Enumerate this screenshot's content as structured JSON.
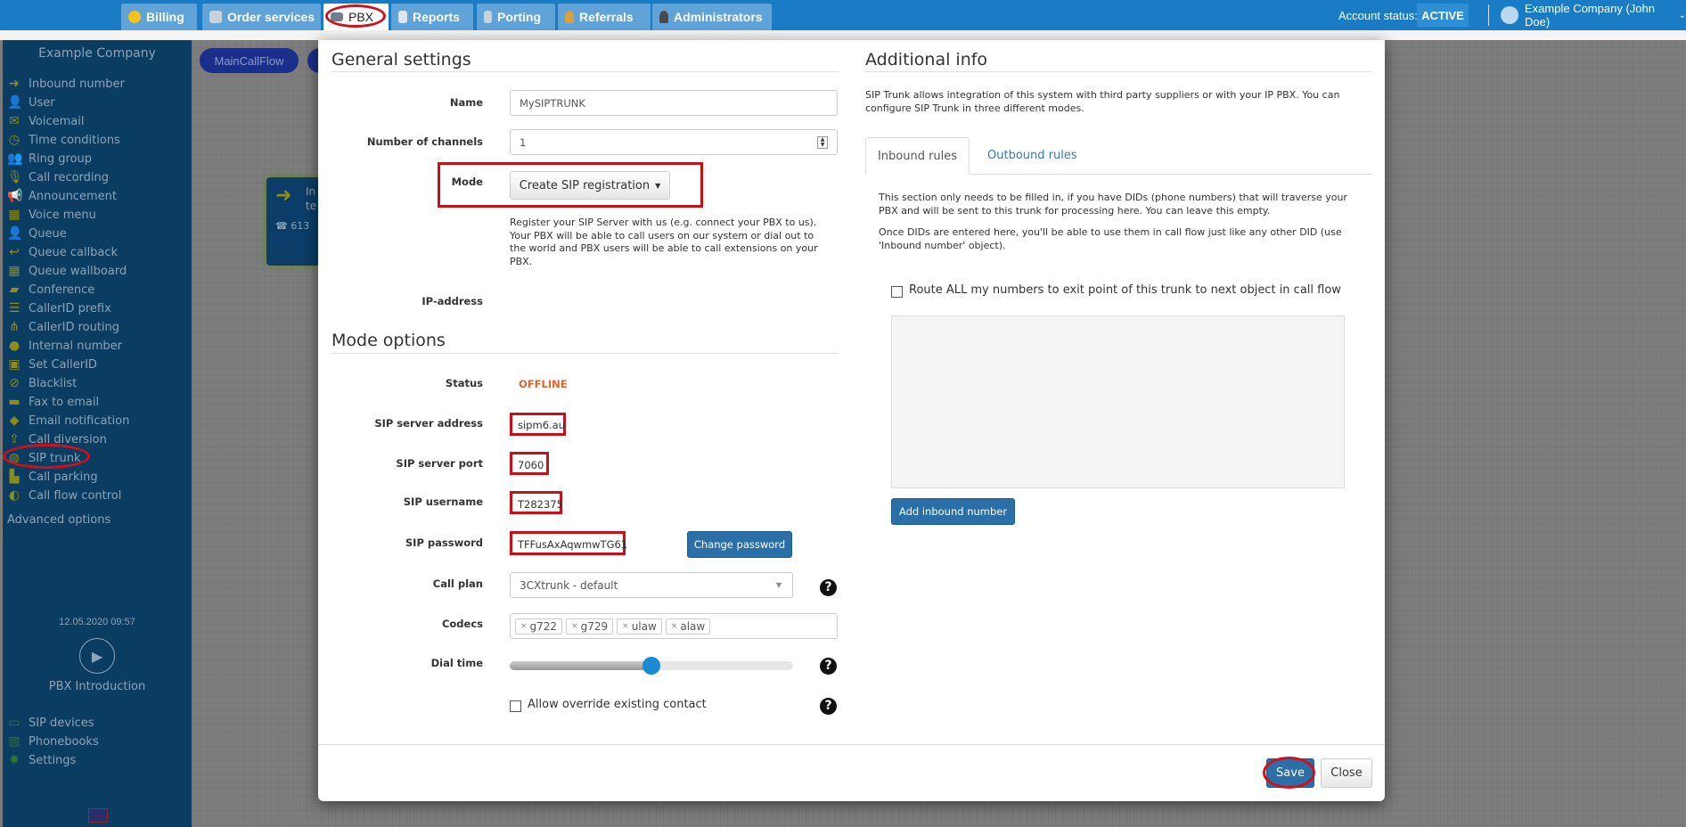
{
  "topnav": {
    "tabs": [
      {
        "label": "Billing",
        "icon": "coins-icon"
      },
      {
        "label": "Order services",
        "icon": "cart-icon"
      },
      {
        "label": "PBX",
        "icon": "pbx-icon",
        "active": true
      },
      {
        "label": "Reports",
        "icon": "report-icon"
      },
      {
        "label": "Porting",
        "icon": "phone-icon"
      },
      {
        "label": "Referrals",
        "icon": "person-icon"
      },
      {
        "label": "Administrators",
        "icon": "admin-icon"
      }
    ],
    "account_status_label": "Account status:",
    "account_status": "ACTIVE",
    "user": "Example Company (John Doe)"
  },
  "sidebar": {
    "company": "Example Company",
    "items": [
      {
        "label": "Inbound number",
        "icon": "arrow-right-icon"
      },
      {
        "label": "User",
        "icon": "user-icon"
      },
      {
        "label": "Voicemail",
        "icon": "envelope-icon"
      },
      {
        "label": "Time conditions",
        "icon": "clock-icon"
      },
      {
        "label": "Ring group",
        "icon": "group-icon"
      },
      {
        "label": "Call recording",
        "icon": "microphone-icon"
      },
      {
        "label": "Announcement",
        "icon": "megaphone-icon"
      },
      {
        "label": "Voice menu",
        "icon": "grid-icon"
      },
      {
        "label": "Queue",
        "icon": "user-plus-icon"
      },
      {
        "label": "Queue callback",
        "icon": "reply-icon"
      },
      {
        "label": "Queue wallboard",
        "icon": "table-icon"
      },
      {
        "label": "Conference",
        "icon": "chat-icon"
      },
      {
        "label": "CallerID prefix",
        "icon": "list-icon"
      },
      {
        "label": "CallerID routing",
        "icon": "sitemap-icon"
      },
      {
        "label": "Internal number",
        "icon": "pin-icon"
      },
      {
        "label": "Set CallerID",
        "icon": "id-card-icon"
      },
      {
        "label": "Blacklist",
        "icon": "ban-icon"
      },
      {
        "label": "Fax to email",
        "icon": "fax-icon"
      },
      {
        "label": "Email notification",
        "icon": "bell-icon"
      },
      {
        "label": "Call diversion",
        "icon": "upload-icon"
      },
      {
        "label": "SIP trunk",
        "icon": "globe-icon"
      },
      {
        "label": "Call parking",
        "icon": "cart-icon"
      },
      {
        "label": "Call flow control",
        "icon": "toggle-icon"
      }
    ],
    "advanced": "Advanced options",
    "datetime": "12.05.2020 09:57",
    "intro": "PBX Introduction",
    "bottom_items": [
      {
        "label": "SIP devices",
        "icon": "monitor-icon"
      },
      {
        "label": "Phonebooks",
        "icon": "book-icon"
      },
      {
        "label": "Settings",
        "icon": "gear-icon"
      }
    ],
    "language": "uk-flag-icon"
  },
  "canvas": {
    "flow_tab": "MainCallFlow",
    "node_title": "In te",
    "node_number": "613"
  },
  "modal": {
    "general": {
      "title": "General settings",
      "name_label": "Name",
      "name_value": "MySIPTRUNK",
      "channels_label": "Number of channels",
      "channels_value": "1",
      "mode_label": "Mode",
      "mode_value": "Create SIP registration",
      "mode_help": "Register your SIP Server with us (e.g. connect your PBX to us). Your PBX will be able to call users on our system or dial out to the world and PBX users will be able to call extensions on your PBX.",
      "ip_label": "IP-address"
    },
    "mode_options": {
      "title": "Mode options",
      "status_label": "Status",
      "status_value": "OFFLINE",
      "status_color": "#e0632a",
      "address_label": "SIP server address",
      "address_value": "sipm6.au",
      "port_label": "SIP server port",
      "port_value": "7060",
      "username_label": "SIP username",
      "username_value": "T282375",
      "password_label": "SIP password",
      "password_value": "TFFusAxAqwmwTG61",
      "change_password": "Change password",
      "callplan_label": "Call plan",
      "callplan_value": "3CXtrunk - default",
      "codecs_label": "Codecs",
      "codecs": [
        "g722",
        "g729",
        "ulaw",
        "alaw"
      ],
      "dialtime_label": "Dial time",
      "dialtime_fraction": 0.5,
      "override_label": "Allow override existing contact",
      "override_checked": false
    },
    "additional": {
      "title": "Additional info",
      "intro": "SIP Trunk allows integration of this system with third party suppliers or with your IP PBX. You can configure SIP Trunk in three different modes.",
      "tabs": [
        "Inbound rules",
        "Outbound rules"
      ],
      "p1": "This section only needs to be filled in, if you have DIDs (phone numbers) that will traverse your PBX and will be sent to this trunk for processing here. You can leave this empty.",
      "p2": "Once DIDs are entered here, you'll be able to use them in call flow just like any other DID (use 'Inbound number' object).",
      "route_all": "Route ALL my numbers to exit point of this trunk to next object in call flow",
      "add_inbound": "Add inbound number"
    },
    "save": "Save",
    "close": "Close"
  }
}
